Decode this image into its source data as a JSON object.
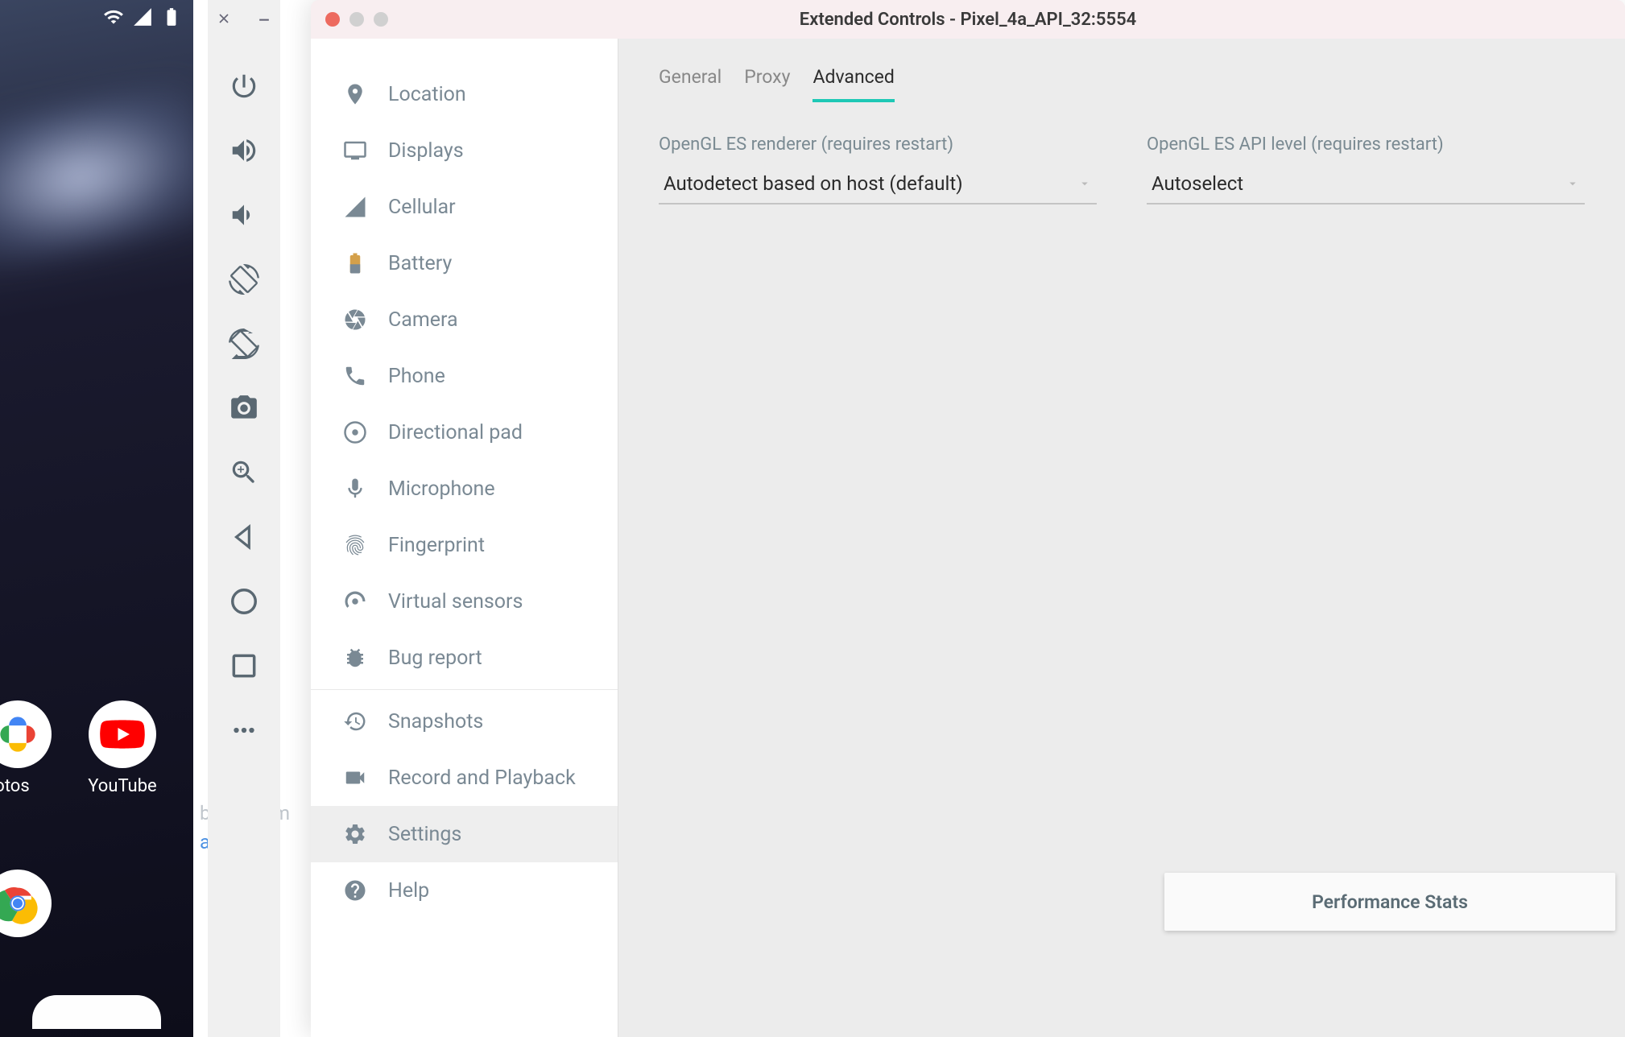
{
  "phone": {
    "apps": {
      "photos_label": "otos",
      "youtube_label": "YouTube"
    },
    "underlay_text1": "back them",
    "underlay_answers": "answers",
    "underlay_period": "."
  },
  "toolbar": {
    "icons": [
      "power",
      "volume-up",
      "volume-down",
      "rotate-left",
      "rotate-right",
      "camera",
      "zoom-in",
      "back",
      "home",
      "overview",
      "more"
    ]
  },
  "window": {
    "title": "Extended Controls - Pixel_4a_API_32:5554"
  },
  "sidebar": {
    "items": [
      {
        "icon": "location",
        "label": "Location"
      },
      {
        "icon": "displays",
        "label": "Displays"
      },
      {
        "icon": "cellular",
        "label": "Cellular"
      },
      {
        "icon": "battery",
        "label": "Battery"
      },
      {
        "icon": "camera",
        "label": "Camera"
      },
      {
        "icon": "phone",
        "label": "Phone"
      },
      {
        "icon": "dpad",
        "label": "Directional pad"
      },
      {
        "icon": "mic",
        "label": "Microphone"
      },
      {
        "icon": "fingerprint",
        "label": "Fingerprint"
      },
      {
        "icon": "sensors",
        "label": "Virtual sensors"
      },
      {
        "icon": "bug",
        "label": "Bug report"
      },
      {
        "icon": "snapshot",
        "label": "Snapshots"
      },
      {
        "icon": "record",
        "label": "Record and Playback"
      },
      {
        "icon": "settings",
        "label": "Settings",
        "selected": true
      },
      {
        "icon": "help",
        "label": "Help"
      }
    ]
  },
  "tabs": [
    {
      "label": "General",
      "active": false
    },
    {
      "label": "Proxy",
      "active": false
    },
    {
      "label": "Advanced",
      "active": true
    }
  ],
  "settings": {
    "renderer": {
      "label": "OpenGL ES renderer (requires restart)",
      "value": "Autodetect based on host (default)"
    },
    "api_level": {
      "label": "OpenGL ES API level (requires restart)",
      "value": "Autoselect"
    }
  },
  "perf_button": "Performance Stats"
}
